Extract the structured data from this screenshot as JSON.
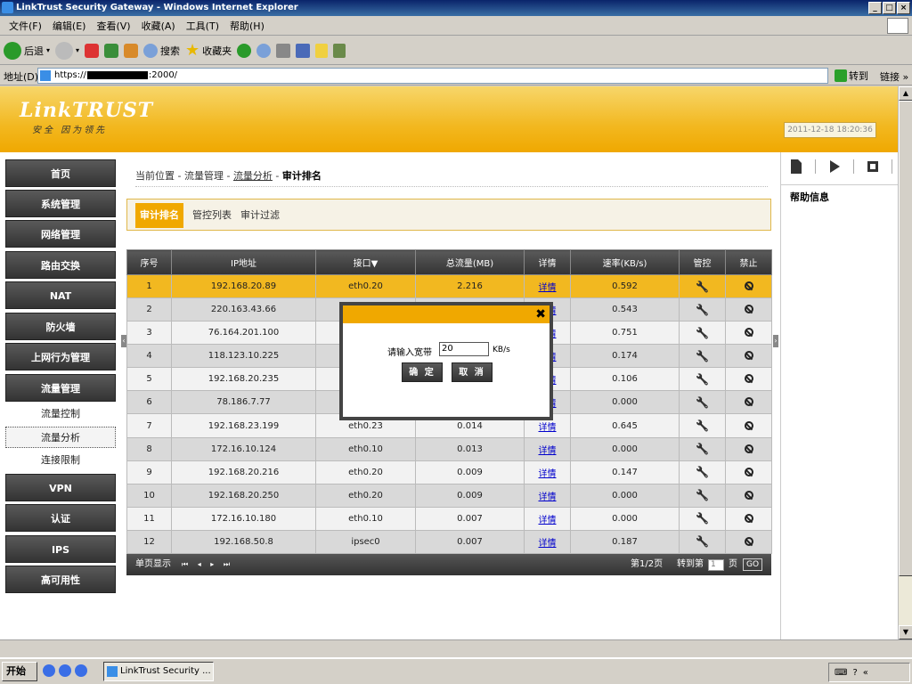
{
  "window": {
    "title": "LinkTrust Security Gateway - Windows Internet Explorer",
    "controls": [
      "_",
      "□",
      "×"
    ]
  },
  "menubar": [
    "文件(F)",
    "编辑(E)",
    "查看(V)",
    "收藏(A)",
    "工具(T)",
    "帮助(H)"
  ],
  "toolbar": {
    "back": "后退",
    "search": "搜索",
    "favorites": "收藏夹"
  },
  "address": {
    "label": "地址(D)",
    "prefix": "https://",
    "suffix": ":2000/",
    "go": "转到",
    "links": "链接 »"
  },
  "header": {
    "logo": "LinkTRUST",
    "slogan": "安全 因为领先",
    "clock": "2011-12-18 18:20:36"
  },
  "sidebar": {
    "items": [
      "首页",
      "系统管理",
      "网络管理",
      "路由交换",
      "NAT",
      "防火墙",
      "上网行为管理",
      "流量管理"
    ],
    "subitems": [
      "流量控制",
      "流量分析",
      "连接限制"
    ],
    "items_after": [
      "VPN",
      "认证",
      "IPS",
      "高可用性"
    ]
  },
  "breadcrumb": {
    "prefix": "当前位置 - 流量管理 - ",
    "link": "流量分析",
    "sep": " - ",
    "current": "审计排名"
  },
  "tabs": [
    "审计排名",
    "管控列表",
    "审计过滤"
  ],
  "table": {
    "headers": [
      "序号",
      "IP地址",
      "接口▼",
      "总流量(MB)",
      "详情",
      "速率(KB/s)",
      "管控",
      "禁止"
    ],
    "detail_label": "详情",
    "rows": [
      [
        "1",
        "192.168.20.89",
        "eth0.20",
        "2.216",
        "0.592"
      ],
      [
        "2",
        "220.163.43.66",
        "",
        "",
        "0.543"
      ],
      [
        "3",
        "76.164.201.100",
        "",
        "",
        "0.751"
      ],
      [
        "4",
        "118.123.10.225",
        "",
        "",
        "0.174"
      ],
      [
        "5",
        "192.168.20.235",
        "",
        "",
        "0.106"
      ],
      [
        "6",
        "78.186.7.77",
        "",
        "",
        "0.000"
      ],
      [
        "7",
        "192.168.23.199",
        "eth0.23",
        "0.014",
        "0.645"
      ],
      [
        "8",
        "172.16.10.124",
        "eth0.10",
        "0.013",
        "0.000"
      ],
      [
        "9",
        "192.168.20.216",
        "eth0.20",
        "0.009",
        "0.147"
      ],
      [
        "10",
        "192.168.20.250",
        "eth0.20",
        "0.009",
        "0.000"
      ],
      [
        "11",
        "172.16.10.180",
        "eth0.10",
        "0.007",
        "0.000"
      ],
      [
        "12",
        "192.168.50.8",
        "ipsec0",
        "0.007",
        "0.187"
      ]
    ]
  },
  "pager": {
    "label": "单页显示",
    "nav": "⏮ ◂ ▸ ⏭",
    "page": "第1/2页",
    "jump": "转到第",
    "input": "1",
    "unit": "页",
    "go": "GO"
  },
  "right_panel": {
    "title": "帮助信息"
  },
  "dialog": {
    "label": "请输入宽带",
    "value": "20",
    "unit": "KB/s",
    "ok": "确 定",
    "cancel": "取 消",
    "close": "✖"
  },
  "taskbar": {
    "start": "开始",
    "task": "LinkTrust Security ..."
  }
}
